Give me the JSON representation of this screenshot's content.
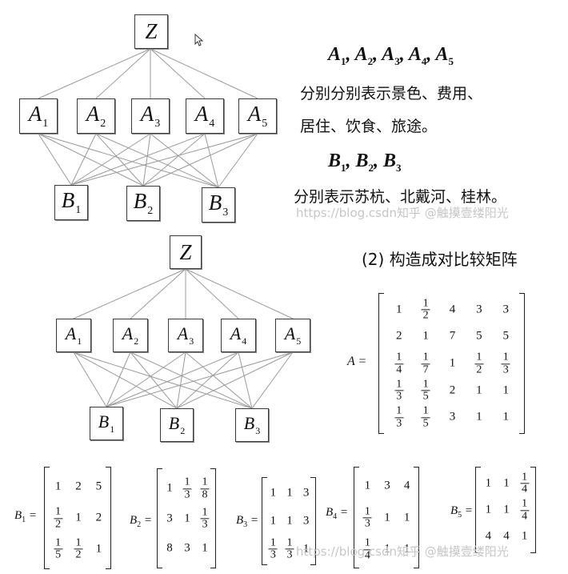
{
  "diagram1": {
    "top": {
      "letter": "Z"
    },
    "criteria": [
      {
        "letter": "A",
        "sub": "1"
      },
      {
        "letter": "A",
        "sub": "2"
      },
      {
        "letter": "A",
        "sub": "3"
      },
      {
        "letter": "A",
        "sub": "4"
      },
      {
        "letter": "A",
        "sub": "5"
      }
    ],
    "alternatives": [
      {
        "letter": "B",
        "sub": "1"
      },
      {
        "letter": "B",
        "sub": "2"
      },
      {
        "letter": "B",
        "sub": "3"
      }
    ]
  },
  "diagram2": {
    "top": {
      "letter": "Z"
    },
    "criteria": [
      {
        "letter": "A",
        "sub": "1"
      },
      {
        "letter": "A",
        "sub": "2"
      },
      {
        "letter": "A",
        "sub": "3"
      },
      {
        "letter": "A",
        "sub": "4"
      },
      {
        "letter": "A",
        "sub": "5"
      }
    ],
    "alternatives": [
      {
        "letter": "B",
        "sub": "1"
      },
      {
        "letter": "B",
        "sub": "2"
      },
      {
        "letter": "B",
        "sub": "3"
      }
    ]
  },
  "explanation": {
    "criteria_line": {
      "letter": "A",
      "subs": [
        "1",
        "2",
        "3",
        "4",
        "5"
      ]
    },
    "criteria_text_1": "分别分别表示景色、费用、",
    "criteria_text_2": "居住、饮食、旅途。",
    "alternatives_line": {
      "letter": "B",
      "subs": [
        "1",
        "2",
        "3"
      ]
    },
    "alternatives_text": "分别表示苏杭、北戴河、桂林。"
  },
  "section_title": "(2) 构造成对比较矩阵",
  "watermarks": {
    "mid": "https://blog.csdn知乎 @触摸壹缕阳光",
    "bottom": "https://blog.csdn知乎 @触摸壹缕阳光"
  },
  "matrices": {
    "A": {
      "name": "A",
      "sub": "",
      "rows": [
        [
          "1",
          "1/2",
          "4",
          "3",
          "3"
        ],
        [
          "2",
          "1",
          "7",
          "5",
          "5"
        ],
        [
          "1/4",
          "1/7",
          "1",
          "1/2",
          "1/3"
        ],
        [
          "1/3",
          "1/5",
          "2",
          "1",
          "1"
        ],
        [
          "1/3",
          "1/5",
          "3",
          "1",
          "1"
        ]
      ]
    },
    "B1": {
      "name": "B",
      "sub": "1",
      "rows": [
        [
          "1",
          "2",
          "5"
        ],
        [
          "1/2",
          "1",
          "2"
        ],
        [
          "1/5",
          "1/2",
          "1"
        ]
      ]
    },
    "B2": {
      "name": "B",
      "sub": "2",
      "rows": [
        [
          "1",
          "1/3",
          "1/8"
        ],
        [
          "3",
          "1",
          "1/3"
        ],
        [
          "8",
          "3",
          "1"
        ]
      ]
    },
    "B3": {
      "name": "B",
      "sub": "3",
      "rows": [
        [
          "1",
          "1",
          "3"
        ],
        [
          "1",
          "1",
          "3"
        ],
        [
          "1/3",
          "1/3",
          "1"
        ]
      ]
    },
    "B4": {
      "name": "B",
      "sub": "4",
      "rows": [
        [
          "1",
          "3",
          "4"
        ],
        [
          "1/3",
          "1",
          "1"
        ],
        [
          "1/4",
          "1",
          "1"
        ]
      ]
    },
    "B5": {
      "name": "B",
      "sub": "5",
      "rows": [
        [
          "1",
          "1",
          "1/4"
        ],
        [
          "1",
          "1",
          "1/4"
        ],
        [
          "4",
          "4",
          "1"
        ]
      ]
    }
  }
}
